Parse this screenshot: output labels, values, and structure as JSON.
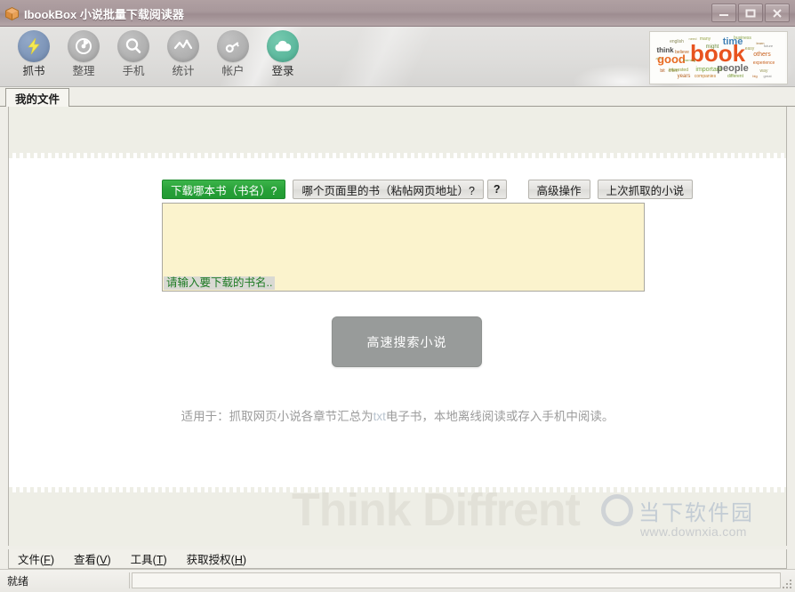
{
  "window": {
    "title": "IbookBox 小说批量下载阅读器",
    "app_icon": "box-icon",
    "minimize_label": "–",
    "maximize_label": "□",
    "close_label": "X"
  },
  "toolbar": {
    "items": [
      {
        "label": "抓书",
        "icon": "lightning-bolt-icon",
        "active": true,
        "circle_color": "#7b93b8",
        "glyph_color": "#f2e85a"
      },
      {
        "label": "整理",
        "icon": "pie-clock-icon",
        "active": false,
        "circle_color": "#b0b0b0",
        "glyph_color": "#ffffff"
      },
      {
        "label": "手机",
        "icon": "magnifier-icon",
        "active": false,
        "circle_color": "#b0b0b0",
        "glyph_color": "#ffffff"
      },
      {
        "label": "统计",
        "icon": "zigzag-chart-icon",
        "active": false,
        "circle_color": "#b0b0b0",
        "glyph_color": "#ffffff"
      },
      {
        "label": "帐户",
        "icon": "key-icon",
        "active": false,
        "circle_color": "#b0b0b0",
        "glyph_color": "#ffffff"
      },
      {
        "label": "登录",
        "icon": "cloud-upload-icon",
        "active": true,
        "circle_color": "#57b79b",
        "glyph_color": "#ffffff"
      }
    ],
    "logo": {
      "name": "book-word-cloud-logo",
      "words": [
        "book",
        "time",
        "good",
        "people",
        "think",
        "important",
        "others",
        "business",
        "companies",
        "different",
        "years",
        "many",
        "believe",
        "work",
        "also",
        "experience",
        "know",
        "learning",
        "value",
        "way",
        "easy",
        "learn",
        "great",
        "big",
        "often"
      ]
    }
  },
  "tabs": [
    {
      "label": "我的文件",
      "active": true
    }
  ],
  "form": {
    "buttons": [
      {
        "label": "下载哪本书（书名）?",
        "style": "primary"
      },
      {
        "label": "哪个页面里的书（粘帖网页地址）?",
        "style": "normal"
      },
      {
        "label": "?",
        "style": "help"
      },
      {
        "label": "高级操作",
        "style": "normal"
      },
      {
        "label": "上次抓取的小说",
        "style": "normal"
      }
    ],
    "textarea": {
      "value": "",
      "placeholder": "",
      "hint": "请输入要下载的书名.."
    },
    "action_button": "高速搜索小说",
    "caption_prefix": "适用于：抓取网页小说各章节汇总为",
    "caption_highlight": "txt",
    "caption_suffix": "电子书，本地离线阅读或存入手机中阅读。"
  },
  "background": {
    "slogan": "Think Diffrent"
  },
  "watermark": {
    "cn": "当下软件园",
    "url": "www.downxia.com"
  },
  "menubar": [
    {
      "text": "文件(",
      "key": "F",
      "tail": ")"
    },
    {
      "text": "查看(",
      "key": "V",
      "tail": ")"
    },
    {
      "text": "工具(",
      "key": "T",
      "tail": ")"
    },
    {
      "text": "获取授权(",
      "key": "H",
      "tail": ")"
    }
  ],
  "statusbar": {
    "text": "就绪",
    "secondary": ""
  },
  "colors": {
    "titlebar": "#a8989b",
    "primary_green": "#27a038",
    "textarea_bg": "#fbf3cd",
    "action_gray": "#989b9a",
    "page_band": "#eeeee6"
  }
}
